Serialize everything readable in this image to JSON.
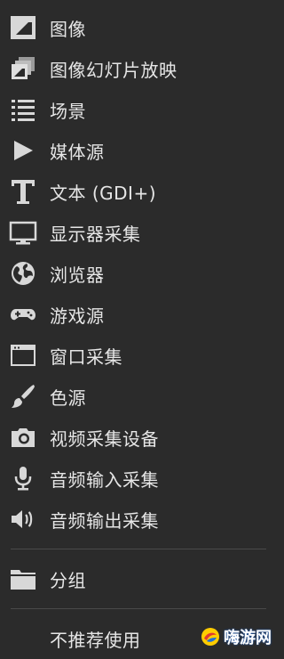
{
  "menu": {
    "items": [
      {
        "label": "图像",
        "icon": "image-icon"
      },
      {
        "label": "图像幻灯片放映",
        "icon": "slideshow-icon"
      },
      {
        "label": "场景",
        "icon": "list-icon"
      },
      {
        "label": "媒体源",
        "icon": "play-icon"
      },
      {
        "label": "文本 (GDI+)",
        "icon": "text-icon"
      },
      {
        "label": "显示器采集",
        "icon": "monitor-icon"
      },
      {
        "label": "浏览器",
        "icon": "globe-icon"
      },
      {
        "label": "游戏源",
        "icon": "gamepad-icon"
      },
      {
        "label": "窗口采集",
        "icon": "window-icon"
      },
      {
        "label": "色源",
        "icon": "brush-icon"
      },
      {
        "label": "视频采集设备",
        "icon": "camera-icon"
      },
      {
        "label": "音频输入采集",
        "icon": "microphone-icon"
      },
      {
        "label": "音频输出采集",
        "icon": "speaker-icon"
      }
    ],
    "group": {
      "label": "分组",
      "icon": "folder-icon"
    },
    "deprecated": {
      "label": "不推荐使用",
      "arrow": "›"
    }
  },
  "watermark": {
    "text": "嗨游网"
  }
}
